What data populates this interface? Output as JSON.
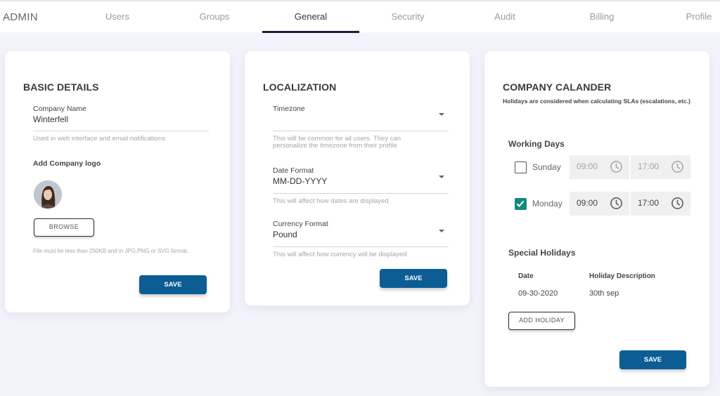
{
  "nav": {
    "brand": "ADMIN",
    "tabs": [
      {
        "label": "Users",
        "active": false
      },
      {
        "label": "Groups",
        "active": false
      },
      {
        "label": "General",
        "active": true
      },
      {
        "label": "Security",
        "active": false
      },
      {
        "label": "Audit",
        "active": false
      },
      {
        "label": "Billing",
        "active": false
      },
      {
        "label": "Profile",
        "active": false
      }
    ]
  },
  "basic_details": {
    "title": "BASIC DETAILS",
    "company_name_label": "Company Name",
    "company_name_value": "Winterfell",
    "company_name_hint": "Used in web interface and email notifications",
    "logo_label": "Add Company logo",
    "browse_label": "BROWSE",
    "file_hint": "File must be less than 250KB and in JPG,PNG or SVG format.",
    "save_label": "SAVE"
  },
  "localization": {
    "title": "LOCALIZATION",
    "timezone_label": "Timezone",
    "timezone_value": "",
    "timezone_hint_1": "This will be common for all users. They can",
    "timezone_hint_2": "personalize the timezone from their profile",
    "date_format_label": "Date Format",
    "date_format_value": "MM-DD-YYYY",
    "date_format_hint": "This will affect how dates are displayed",
    "currency_label": "Currency Format",
    "currency_value": "Pound",
    "currency_hint": "This will affect how currency will be displayed",
    "save_label": "SAVE"
  },
  "calendar": {
    "title": "COMPANY CALANDER",
    "description": "Holidays are considered when calculating SLAs (escalations, etc.)",
    "working_days_title": "Working Days",
    "days": [
      {
        "name": "Sunday",
        "checked": false,
        "start": "09:00",
        "end": "17:00"
      },
      {
        "name": "Monday",
        "checked": true,
        "start": "09:00",
        "end": "17:00"
      }
    ],
    "special_holidays_title": "Special Holidays",
    "holiday_columns": [
      "Date",
      "Holiday Description"
    ],
    "holidays": [
      {
        "date": "09-30-2020",
        "description": "30th sep"
      }
    ],
    "add_holiday_label": "ADD HOLIDAY",
    "save_label": "SAVE",
    "colors": {
      "checked": "#138a7a",
      "primary_button": "#0b5d94"
    }
  }
}
